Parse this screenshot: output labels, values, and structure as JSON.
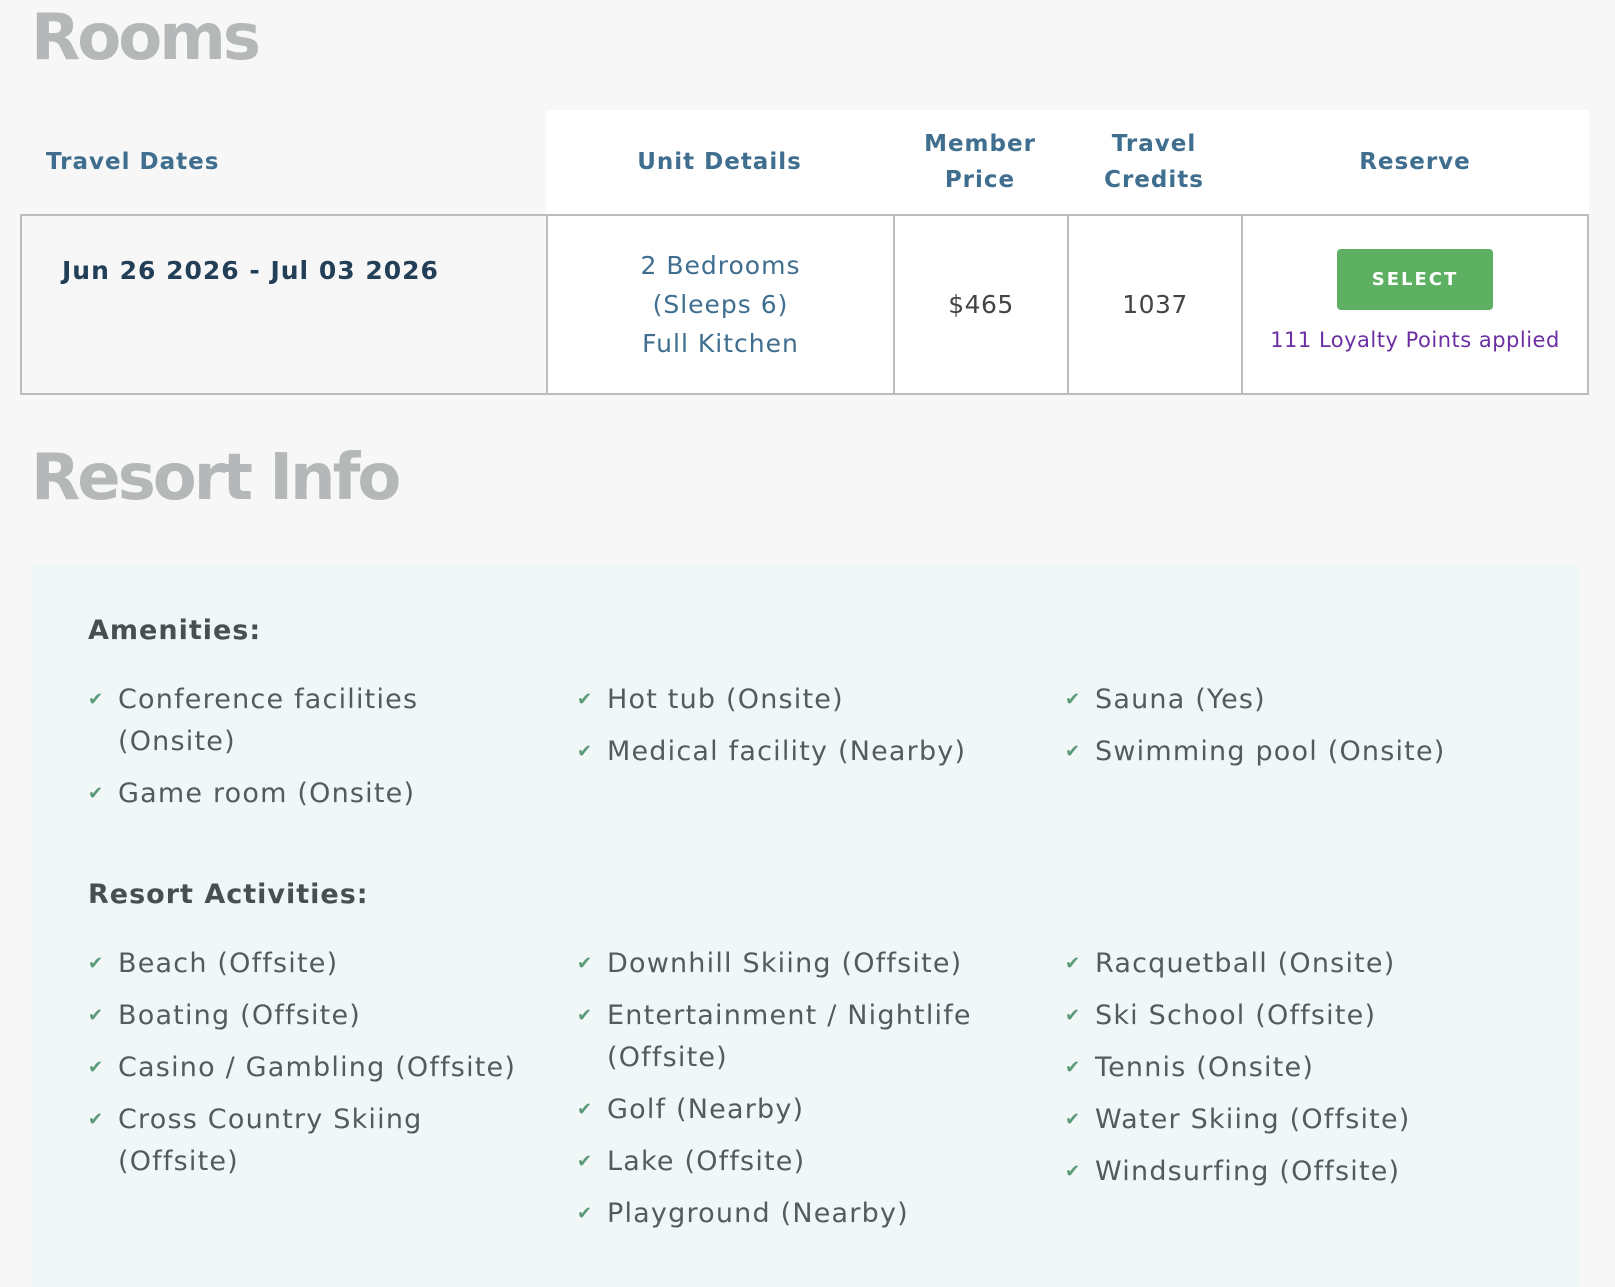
{
  "rooms_title": "Rooms",
  "resort_title": "Resort Info",
  "table": {
    "headers": {
      "travel_dates": "Travel Dates",
      "unit_details": "Unit Details",
      "member_price": "Member\nPrice",
      "travel_credits": "Travel\nCredits",
      "reserve": "Reserve"
    },
    "row": {
      "dates": "Jun 26 2026 - Jul 03 2026",
      "unit_line1": "2 Bedrooms",
      "unit_line2": "(Sleeps 6)",
      "unit_line3": "Full Kitchen",
      "price": "$465",
      "credits": "1037",
      "select_label": "SELECT",
      "loyalty": "111 Loyalty Points applied"
    }
  },
  "amenities": {
    "heading": "Amenities:",
    "col1": [
      "Conference facilities (Onsite)",
      "Game room (Onsite)"
    ],
    "col2": [
      "Hot tub (Onsite)",
      "Medical facility (Nearby)"
    ],
    "col3": [
      "Sauna (Yes)",
      "Swimming pool (Onsite)"
    ]
  },
  "activities": {
    "heading": "Resort Activities:",
    "col1": [
      "Beach (Offsite)",
      "Boating (Offsite)",
      "Casino / Gambling (Offsite)",
      "Cross Country Skiing (Offsite)"
    ],
    "col2": [
      "Downhill Skiing (Offsite)",
      "Entertainment / Nightlife (Offsite)",
      "Golf (Nearby)",
      "Lake (Offsite)",
      "Playground (Nearby)"
    ],
    "col3": [
      "Racquetball (Onsite)",
      "Ski School (Offsite)",
      "Tennis (Onsite)",
      "Water Skiing (Offsite)",
      "Windsurfing (Offsite)"
    ]
  },
  "icons": {
    "check": "check-icon"
  },
  "colors": {
    "heading_blue": "#3f6e8f",
    "select_green": "#5daf62",
    "loyalty_purple": "#6c2fa3",
    "panel_bg": "#f1f7f7"
  }
}
